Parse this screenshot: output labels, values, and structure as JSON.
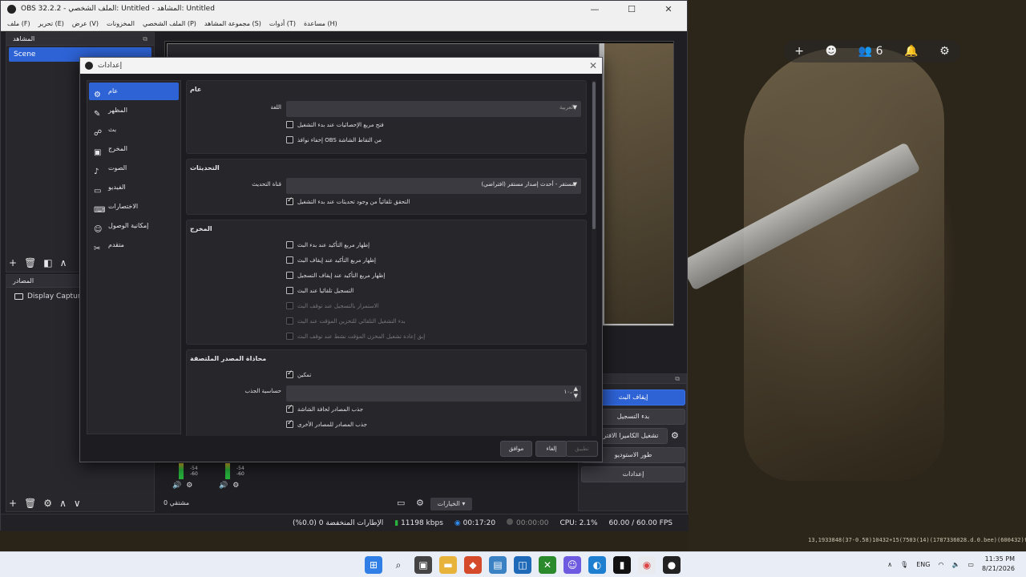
{
  "window": {
    "title": "OBS 32.2.2 - الملف الشخصي: Untitled - المشاهد: Untitled"
  },
  "menubar": [
    "ملف (F)",
    "تحرير (E)",
    "عرض (V)",
    "المخزونات",
    "الملف الشخصي (P)",
    "مجموعة المشاهد (S)",
    "أدوات (T)",
    "مساعدة (H)"
  ],
  "scenes_dock": {
    "title": "المشاهد",
    "items": [
      "Scene"
    ]
  },
  "sources_dock": {
    "title": "المصادر",
    "items": [
      "Display Capture"
    ]
  },
  "controls": {
    "buttons": [
      "إيقاف البث",
      "بدء التسجيل",
      "تشغيل الكاميرا الافتراضية",
      "طور الاستوديو",
      "إعدادات"
    ]
  },
  "mixer": {
    "label_a": "مشتقي 0",
    "db_a": "-54",
    "db_b": "-60",
    "options_label": "الخيارات"
  },
  "statusbar": {
    "dropped": "الإطارات المنخفضة 0 (0.0%)",
    "bitrate": "11198 kbps",
    "stream_time": "00:17:20",
    "rec_time": "00:00:00",
    "cpu": "CPU: 2.1%",
    "fps": "60.00 / 60.00 FPS"
  },
  "dialog": {
    "title": "إعدادات",
    "sidebar": [
      "عام",
      "المظهر",
      "بث",
      "المخرج",
      "الصوت",
      "الفيديو",
      "الاختصارات",
      "إمكانية الوصول",
      "متقدم"
    ],
    "general": {
      "title": "عام",
      "language_label": "اللغة",
      "language_value": "العربية",
      "cb1": "فتح مربع الإحصائيات عند بدء التشغيل",
      "cb2": "إخفاء نوافذ OBS من التقاط الشاشة"
    },
    "updates": {
      "title": "التحديثات",
      "channel_label": "قناة التحديث",
      "channel_value": "مستقر - أحدث إصدار مستقر (افتراضي)",
      "cb1": "التحقق تلقائياً من وجود تحديثات عند بدء التشغيل"
    },
    "output": {
      "title": "المخرج",
      "cb1": "إظهار مربع التأكيد عند بدء البث",
      "cb2": "إظهار مربع التأكيد عند إيقاف البث",
      "cb3": "إظهار مربع التأكيد عند إيقاف التسجيل",
      "cb4": "التسجيل تلقائيا عند البث",
      "cb5": "الاستمرار بالتسجيل عند توقف البث",
      "cb6": "بدء التشغيل التلقائي للتخزين المؤقت عند البث",
      "cb7": "إبق إعادة تشغيل المخزن المؤقت نشط عند توقف البث"
    },
    "snapping": {
      "title": "محاذاة المصدر الملتصقة",
      "enable": "تمكين",
      "sensitivity_label": "حساسية الجذب",
      "sensitivity_value": "١٠،٠",
      "cb1": "جذب المصادر لحافة الشاشة",
      "cb2": "جذب المصادر للمصادر الأخرى"
    },
    "buttons": {
      "ok": "موافق",
      "cancel": "إلغاء",
      "apply": "تطبيق"
    }
  },
  "wallpaper": {
    "friends_count": "6",
    "coords": "13,1933848(37-0.58)10432+15(7503(14)(1787336028.d.0.bee)(600432)ffff"
  },
  "taskbar": {
    "lang": "ENG",
    "time": "11:35 PM",
    "date": "8/21/2026"
  }
}
